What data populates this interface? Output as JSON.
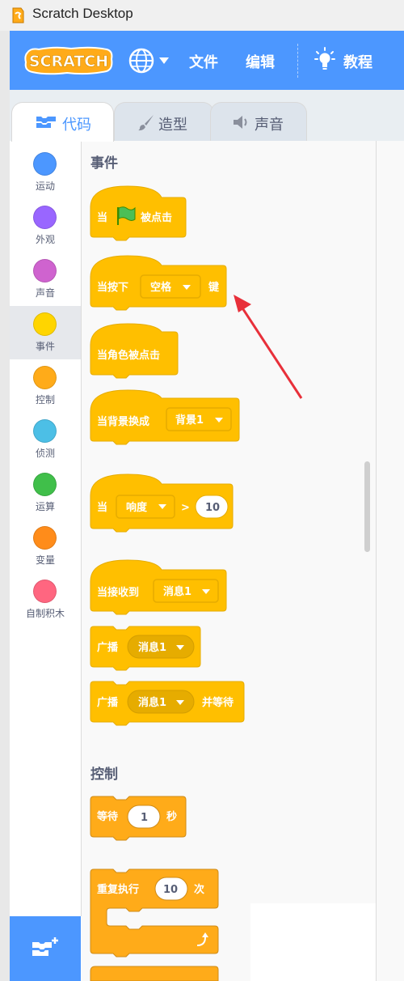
{
  "window": {
    "title": "Scratch Desktop"
  },
  "menubar": {
    "logo_text": "SCRATCH",
    "file": "文件",
    "edit": "编辑",
    "tutorials": "教程"
  },
  "tabs": {
    "code": "代码",
    "costumes": "造型",
    "sounds": "声音"
  },
  "categories": [
    {
      "label": "运动",
      "color": "#4c97ff"
    },
    {
      "label": "外观",
      "color": "#9966ff"
    },
    {
      "label": "声音",
      "color": "#cf63cf"
    },
    {
      "label": "事件",
      "color": "#ffd500"
    },
    {
      "label": "控制",
      "color": "#ffab19"
    },
    {
      "label": "侦测",
      "color": "#4cbfe6"
    },
    {
      "label": "运算",
      "color": "#40bf4a"
    },
    {
      "label": "变量",
      "color": "#ff8c1a"
    },
    {
      "label": "自制积木",
      "color": "#ff6680"
    }
  ],
  "selected_category": "事件",
  "palette": {
    "events_label": "事件",
    "control_label": "控制",
    "blocks": {
      "flag_when": "当",
      "flag_clicked": "被点击",
      "key_when": "当按下",
      "key_value": "空格",
      "key_suffix": "键",
      "sprite_clicked": "当角色被点击",
      "backdrop_switch": "当背景换成",
      "backdrop_value": "背景1",
      "greater_when": "当",
      "greater_option": "响度",
      "greater_symbol": ">",
      "greater_value": "10",
      "receive": "当接收到",
      "receive_value": "消息1",
      "broadcast": "广播",
      "broadcast_value": "消息1",
      "broadcast_wait": "广播",
      "broadcast_wait_value": "消息1",
      "broadcast_wait_suffix": "并等待",
      "wait": "等待",
      "wait_value": "1",
      "wait_unit": "秒",
      "repeat": "重复执行",
      "repeat_value": "10",
      "repeat_unit": "次"
    }
  },
  "colors": {
    "menubar": "#4c97ff",
    "events_block": "#ffbf00",
    "events_block_border": "#e6ac00",
    "control_block": "#ffab19",
    "annotation_arrow": "#e8303a"
  }
}
